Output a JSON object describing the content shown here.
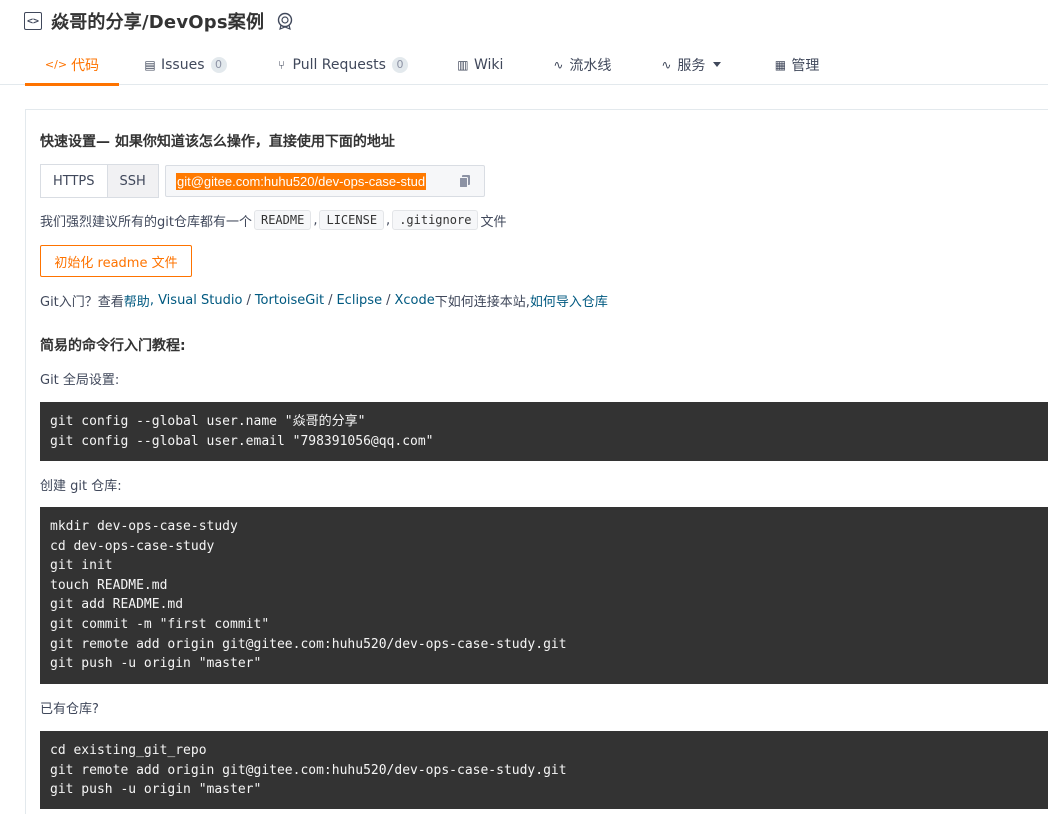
{
  "repo": {
    "icon_glyph": "<>",
    "title": "焱哥的分享/DevOps案例"
  },
  "tabs": [
    {
      "icon": "</>",
      "label": "代码",
      "active": true
    },
    {
      "icon": "▤",
      "label": "Issues",
      "count": "0"
    },
    {
      "icon": "⑂",
      "label": "Pull Requests",
      "count": "0"
    },
    {
      "icon": "▥",
      "label": "Wiki"
    },
    {
      "icon": "∿",
      "label": "流水线"
    },
    {
      "icon": "∿",
      "label": "服务"
    },
    {
      "icon": "▦",
      "label": "管理"
    }
  ],
  "quick_setup": {
    "heading": "快速设置— 如果你知道该怎么操作，直接使用下面的地址",
    "https_label": "HTTPS",
    "ssh_label": "SSH",
    "url": "git@gitee.com:huhu520/dev-ops-case-stud",
    "suggest_prefix": "我们强烈建议所有的git仓库都有一个",
    "readme_chip": "README",
    "license_chip": "LICENSE",
    "gitignore_chip": ".gitignore",
    "comma": ",",
    "suggest_suffix": "文件",
    "init_button": "初始化 readme 文件"
  },
  "git_intro": {
    "prefix": "Git入门？查看 ",
    "help": "帮助",
    "vs": ", Visual Studio",
    "slash": "/",
    "tortoise": "TortoiseGit",
    "eclipse": "Eclipse",
    "xcode": "Xcode",
    "middle": " 下如何连接本站, ",
    "import": "如何导入仓库"
  },
  "tutorial": {
    "heading": "简易的命令行入门教程:",
    "global_label": "Git 全局设置:",
    "global_code": [
      "git config --global user.name \"焱哥的分享\"",
      "git config --global user.email \"798391056@qq.com\""
    ],
    "create_label": "创建 git 仓库:",
    "create_code": [
      "mkdir dev-ops-case-study",
      "cd dev-ops-case-study",
      "git init",
      "touch README.md",
      "git add README.md",
      "git commit -m \"first commit\"",
      "git remote add origin git@gitee.com:huhu520/dev-ops-case-study.git",
      "git push -u origin \"master\""
    ],
    "existing_label": "已有仓库?",
    "existing_code": [
      "cd existing_git_repo",
      "git remote add origin git@gitee.com:huhu520/dev-ops-case-study.git",
      "git push -u origin \"master\""
    ]
  },
  "colors": {
    "accent": "#fe7300",
    "link": "#005980",
    "code_bg": "#333333"
  }
}
